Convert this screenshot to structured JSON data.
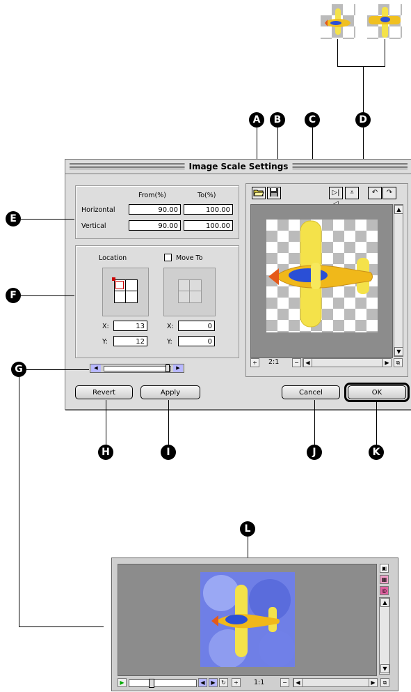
{
  "dialog": {
    "title": "Image Scale Settings",
    "scale": {
      "header_from": "From(%)",
      "header_to": "To(%)",
      "horizontal_label": "Horizontal",
      "vertical_label": "Vertical",
      "h_from": "90.00",
      "h_to": "100.00",
      "v_from": "90.00",
      "v_to": "100.00"
    },
    "location": {
      "label": "Location",
      "x_label": "X:",
      "y_label": "Y:",
      "x_value": "13",
      "y_value": "12"
    },
    "move_to": {
      "label": "Move To",
      "x_label": "X:",
      "y_label": "Y:",
      "x_value": "0",
      "y_value": "0"
    },
    "preview": {
      "zoom": "2:1"
    },
    "buttons": {
      "revert": "Revert",
      "apply": "Apply",
      "cancel": "Cancel",
      "ok": "OK"
    }
  },
  "viewer": {
    "zoom": "1:1"
  },
  "callouts": [
    "A",
    "B",
    "C",
    "D",
    "E",
    "F",
    "G",
    "H",
    "I",
    "J",
    "K",
    "L"
  ],
  "icons": [
    "open-folder-icon",
    "save-disk-icon",
    "flip-horizontal-icon",
    "flip-vertical-icon",
    "rotate-left-icon",
    "rotate-right-icon",
    "zoom-in-icon",
    "zoom-out-icon",
    "play-icon"
  ],
  "colors": {
    "window_bg": "#dddddd",
    "preview_gray": "#8c8c8c",
    "plane_yellow": "#f4e24a",
    "plane_blue": "#2a4fd6"
  }
}
